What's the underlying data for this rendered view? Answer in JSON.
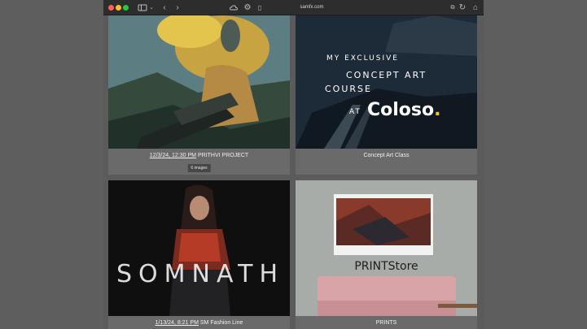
{
  "browser": {
    "url": "samfx.com"
  },
  "tiles": [
    {
      "date": "12/3/24, 12:30 PM",
      "title": "PRITHVI PROJECT",
      "badge": "6 images"
    },
    {
      "title": "Concept Art Class",
      "overlay_line1": "MY EXCLUSIVE",
      "overlay_line2": "CONCEPT ART",
      "overlay_line3": "COURSE",
      "overlay_at": "AT",
      "overlay_brand": "Coloso"
    },
    {
      "date": "1/13/24, 8:21 PM",
      "title": "SM Fashion Line",
      "overlay_word": "SOMNATH"
    },
    {
      "title": "PRINTS",
      "overlay_store": "PRINTStore"
    }
  ]
}
